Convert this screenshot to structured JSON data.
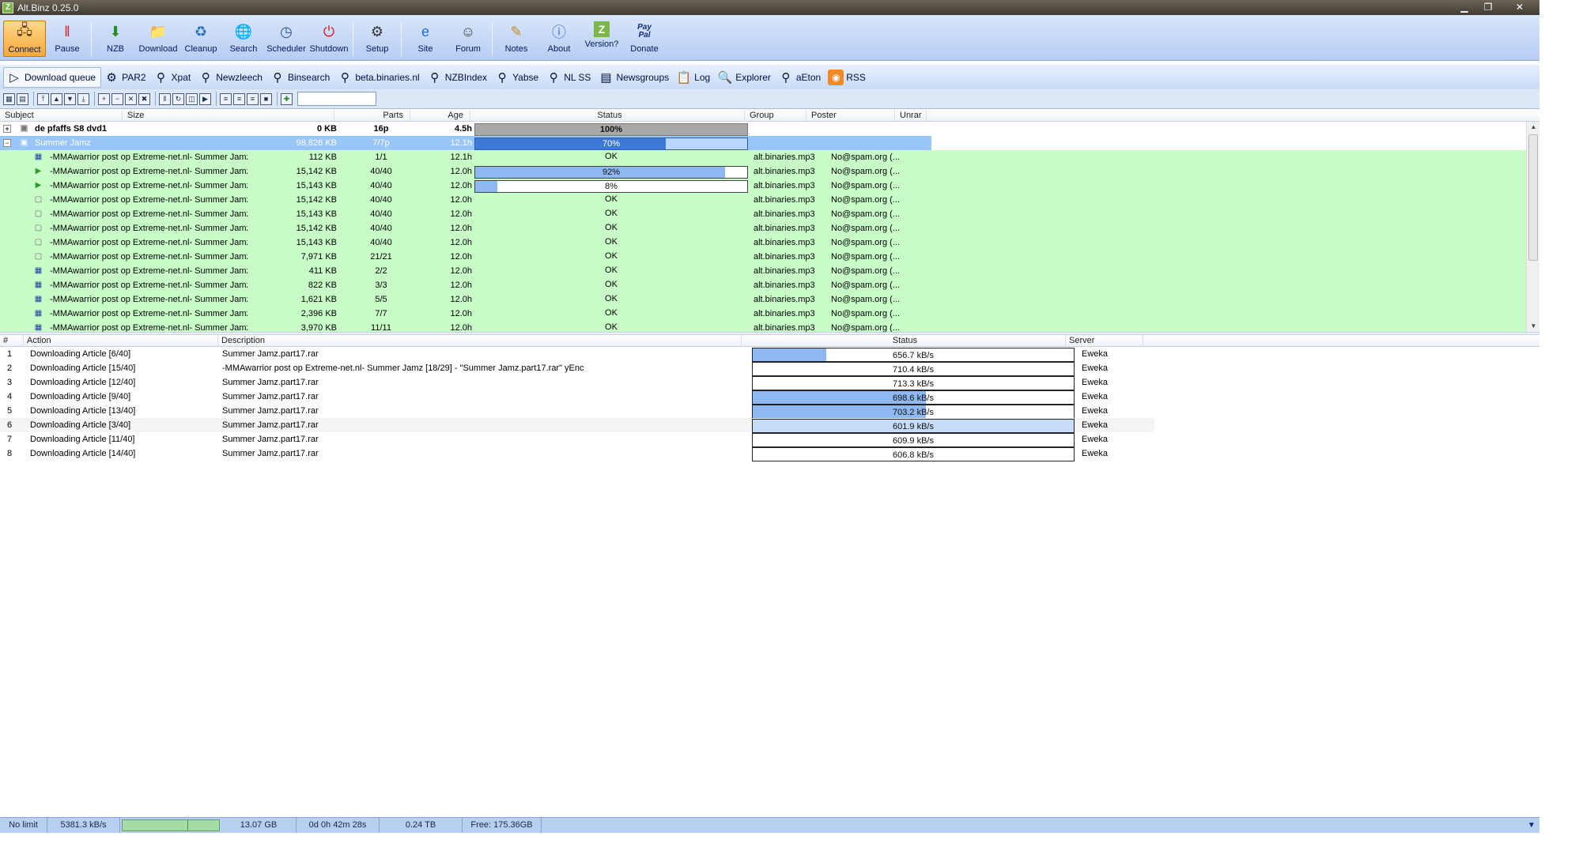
{
  "window": {
    "title": "Alt.Binz 0.25.0",
    "app_icon_letter": "Z",
    "min": "▁",
    "max": "❐",
    "close": "✕"
  },
  "toolbar": {
    "buttons": [
      {
        "label": "Connect",
        "icon": "connect-icon"
      },
      {
        "label": "Pause",
        "icon": "pause-icon"
      },
      {
        "label": "NZB",
        "icon": "nzb-icon"
      },
      {
        "label": "Download",
        "icon": "folder-icon"
      },
      {
        "label": "Cleanup",
        "icon": "cleanup-icon"
      },
      {
        "label": "Search",
        "icon": "globe-icon"
      },
      {
        "label": "Scheduler",
        "icon": "clock-icon"
      },
      {
        "label": "Shutdown",
        "icon": "power-icon"
      },
      {
        "label": "Setup",
        "icon": "gear-icon"
      },
      {
        "label": "Site",
        "icon": "ie-icon"
      },
      {
        "label": "Forum",
        "icon": "forum-icon"
      },
      {
        "label": "Notes",
        "icon": "notes-icon"
      },
      {
        "label": "About",
        "icon": "info-icon"
      },
      {
        "label": "Version?",
        "icon": "version-icon"
      },
      {
        "label": "Donate",
        "icon": "paypal-icon"
      }
    ],
    "paypal_glyph": "Pay\nPal",
    "version_glyph": "Z"
  },
  "searchbar": {
    "items": [
      "Download queue",
      "PAR2",
      "Xpat",
      "Newzleech",
      "Binsearch",
      "beta.binaries.nl",
      "NZBIndex",
      "Yabse",
      "NL SS",
      "Newsgroups",
      "Log",
      "Explorer",
      "aEton",
      "RSS"
    ]
  },
  "queue": {
    "columns": [
      "Subject",
      "Size",
      "Parts",
      "Age",
      "Status",
      "Group",
      "Poster",
      "Unrar"
    ],
    "groups": [
      {
        "subject": "de pfaffs S8 dvd1",
        "size": "0 KB",
        "parts": "16p",
        "age": "4.5h",
        "status": "100%",
        "progress": 1.0,
        "expand": "+"
      },
      {
        "subject": "Summer Jamz",
        "size": "98,826 KB",
        "parts": "7/7p",
        "age": "12.1h",
        "status": "70%",
        "progress": 0.7,
        "expand": "−"
      }
    ],
    "files": [
      {
        "subject": "-MMAwarrior post op Extreme-net.nl- Summer Jamz [...",
        "size": "112 KB",
        "parts": "1/1",
        "age": "12.1h",
        "status": "OK",
        "group": "alt.binaries.mp3",
        "poster": "No@spam.org (...",
        "icon": "par-file-icon"
      },
      {
        "subject": "-MMAwarrior post op Extreme-net.nl- Summer Jamz [...",
        "size": "15,142 KB",
        "parts": "40/40",
        "age": "12.0h",
        "status": "92%",
        "progress": 0.92,
        "group": "alt.binaries.mp3",
        "poster": "No@spam.org (...",
        "icon": "play-icon"
      },
      {
        "subject": "-MMAwarrior post op Extreme-net.nl- Summer Jamz [...",
        "size": "15,143 KB",
        "parts": "40/40",
        "age": "12.0h",
        "status": "8%",
        "progress": 0.08,
        "group": "alt.binaries.mp3",
        "poster": "No@spam.org (...",
        "icon": "play-icon"
      },
      {
        "subject": "-MMAwarrior post op Extreme-net.nl- Summer Jamz [...",
        "size": "15,142 KB",
        "parts": "40/40",
        "age": "12.0h",
        "status": "OK",
        "group": "alt.binaries.mp3",
        "poster": "No@spam.org (...",
        "icon": "file-icon"
      },
      {
        "subject": "-MMAwarrior post op Extreme-net.nl- Summer Jamz [...",
        "size": "15,143 KB",
        "parts": "40/40",
        "age": "12.0h",
        "status": "OK",
        "group": "alt.binaries.mp3",
        "poster": "No@spam.org (...",
        "icon": "file-icon"
      },
      {
        "subject": "-MMAwarrior post op Extreme-net.nl- Summer Jamz [...",
        "size": "15,142 KB",
        "parts": "40/40",
        "age": "12.0h",
        "status": "OK",
        "group": "alt.binaries.mp3",
        "poster": "No@spam.org (...",
        "icon": "file-icon"
      },
      {
        "subject": "-MMAwarrior post op Extreme-net.nl- Summer Jamz [...",
        "size": "15,143 KB",
        "parts": "40/40",
        "age": "12.0h",
        "status": "OK",
        "group": "alt.binaries.mp3",
        "poster": "No@spam.org (...",
        "icon": "file-icon"
      },
      {
        "subject": "-MMAwarrior post op Extreme-net.nl- Summer Jamz [...",
        "size": "7,971 KB",
        "parts": "21/21",
        "age": "12.0h",
        "status": "OK",
        "group": "alt.binaries.mp3",
        "poster": "No@spam.org (...",
        "icon": "file-icon"
      },
      {
        "subject": "-MMAwarrior post op Extreme-net.nl- Summer Jamz [...",
        "size": "411 KB",
        "parts": "2/2",
        "age": "12.0h",
        "status": "OK",
        "group": "alt.binaries.mp3",
        "poster": "No@spam.org (...",
        "icon": "par-file-icon"
      },
      {
        "subject": "-MMAwarrior post op Extreme-net.nl- Summer Jamz [...",
        "size": "822 KB",
        "parts": "3/3",
        "age": "12.0h",
        "status": "OK",
        "group": "alt.binaries.mp3",
        "poster": "No@spam.org (...",
        "icon": "par-file-icon"
      },
      {
        "subject": "-MMAwarrior post op Extreme-net.nl- Summer Jamz [...",
        "size": "1,621 KB",
        "parts": "5/5",
        "age": "12.0h",
        "status": "OK",
        "group": "alt.binaries.mp3",
        "poster": "No@spam.org (...",
        "icon": "par-file-icon"
      },
      {
        "subject": "-MMAwarrior post op Extreme-net.nl- Summer Jamz [...",
        "size": "2,396 KB",
        "parts": "7/7",
        "age": "12.0h",
        "status": "OK",
        "group": "alt.binaries.mp3",
        "poster": "No@spam.org (...",
        "icon": "par-file-icon"
      },
      {
        "subject": "-MMAwarrior post op Extreme-net.nl- Summer Jamz [...",
        "size": "3,970 KB",
        "parts": "11/11",
        "age": "12.0h",
        "status": "OK",
        "group": "alt.binaries.mp3",
        "poster": "No@spam.org (...",
        "icon": "par-file-icon"
      }
    ]
  },
  "connections": {
    "columns": [
      "#",
      "Action",
      "Description",
      "Status",
      "Server"
    ],
    "rows": [
      {
        "n": "1",
        "action": "Downloading Article [6/40]",
        "desc": "Summer Jamz.part17.rar",
        "speed": "656.7 kB/s",
        "level": 0.23,
        "server": "Eweka"
      },
      {
        "n": "2",
        "action": "Downloading Article [15/40]",
        "desc": "-MMAwarrior post op Extreme-net.nl- Summer Jamz [18/29] - \"Summer Jamz.part17.rar\" yEnc",
        "speed": "710.4 kB/s",
        "level": 0.0,
        "server": "Eweka"
      },
      {
        "n": "3",
        "action": "Downloading Article [12/40]",
        "desc": "Summer Jamz.part17.rar",
        "speed": "713.3 kB/s",
        "level": 0.0,
        "server": "Eweka"
      },
      {
        "n": "4",
        "action": "Downloading Article [9/40]",
        "desc": "Summer Jamz.part17.rar",
        "speed": "698.6 kB/s",
        "level": 0.54,
        "server": "Eweka"
      },
      {
        "n": "5",
        "action": "Downloading Article [13/40]",
        "desc": "Summer Jamz.part17.rar",
        "speed": "703.2 kB/s",
        "level": 0.54,
        "server": "Eweka"
      },
      {
        "n": "6",
        "action": "Downloading Article [3/40]",
        "desc": "Summer Jamz.part17.rar",
        "speed": "601.9 kB/s",
        "level": 1.0,
        "server": "Eweka"
      },
      {
        "n": "7",
        "action": "Downloading Article [11/40]",
        "desc": "Summer Jamz.part17.rar",
        "speed": "609.9 kB/s",
        "level": 0.0,
        "server": "Eweka"
      },
      {
        "n": "8",
        "action": "Downloading Article [14/40]",
        "desc": "Summer Jamz.part17.rar",
        "speed": "606.8 kB/s",
        "level": 0.0,
        "server": "Eweka"
      }
    ]
  },
  "statusbar": {
    "limit": "No limit",
    "speed": "5381.3 kB/s",
    "remaining_size": "13.07 GB",
    "eta": "0d 0h 42m 28s",
    "total": "0.24 TB",
    "free": "Free: 175.36GB",
    "dropdown": "▼",
    "progress": 0.66
  },
  "colors": {
    "accent": "#3d7ad8",
    "row_green": "#c8fdc8",
    "selected": "#99c6f6"
  }
}
